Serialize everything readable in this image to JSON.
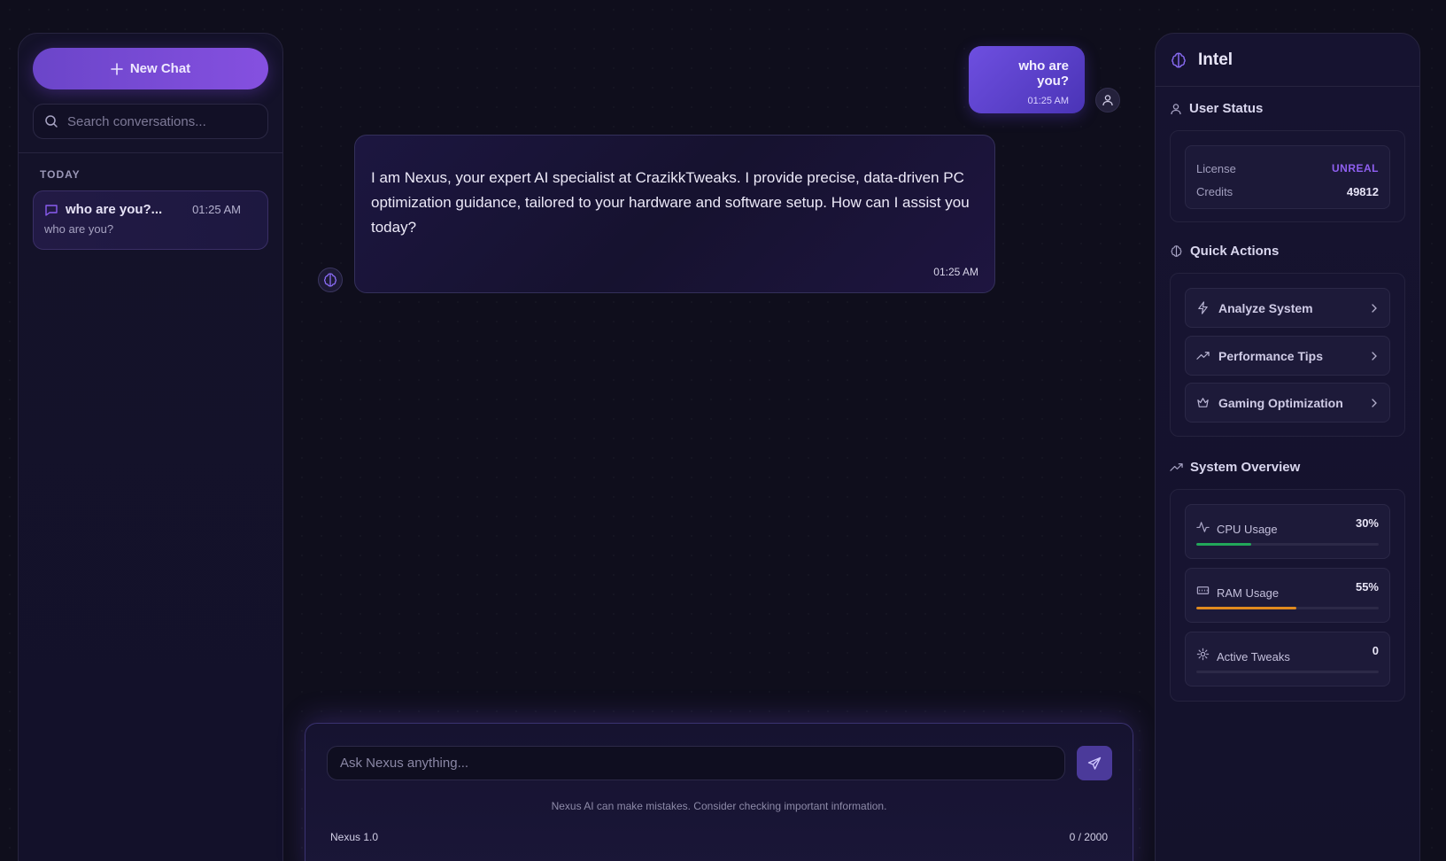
{
  "sidebar": {
    "new_chat_label": "New Chat",
    "search_placeholder": "Search conversations...",
    "section_label": "TODAY",
    "conversations": [
      {
        "title": "who are you?...",
        "time": "01:25 AM",
        "preview": "who are you?"
      }
    ]
  },
  "chat": {
    "messages": [
      {
        "role": "user",
        "text": "who are you?",
        "time": "01:25 AM"
      },
      {
        "role": "assistant",
        "text": "I am Nexus, your expert AI specialist at CrazikkTweaks. I provide precise, data-driven PC optimization guidance, tailored to your hardware and software setup. How can I assist you today?",
        "time": "01:25 AM"
      }
    ]
  },
  "composer": {
    "placeholder": "Ask Nexus anything...",
    "disclaimer": "Nexus AI can make mistakes. Consider checking important information.",
    "model": "Nexus 1.0",
    "char_count": "0 / 2000"
  },
  "intel": {
    "title": "Intel",
    "user_status": {
      "title": "User Status",
      "license_label": "License",
      "license_value": "UNREAL",
      "credits_label": "Credits",
      "credits_value": "49812"
    },
    "quick_actions": {
      "title": "Quick Actions",
      "items": [
        {
          "label": "Analyze System",
          "icon": "lightning-icon"
        },
        {
          "label": "Performance Tips",
          "icon": "trending-up-icon"
        },
        {
          "label": "Gaming Optimization",
          "icon": "crown-icon"
        }
      ]
    },
    "system_overview": {
      "title": "System Overview",
      "metrics": [
        {
          "label": "CPU Usage",
          "value": "30%",
          "percent": 30,
          "color": "#22a85a",
          "icon": "activity-icon"
        },
        {
          "label": "RAM Usage",
          "value": "55%",
          "percent": 55,
          "color": "#e08a1e",
          "icon": "memory-icon"
        },
        {
          "label": "Active Tweaks",
          "value": "0",
          "percent": 0,
          "color": "#7c5ce0",
          "icon": "gear-icon"
        }
      ]
    }
  },
  "colors": {
    "accent": "#7c5ce0",
    "background": "#0f0e1c",
    "license": "#8f5ff0"
  }
}
